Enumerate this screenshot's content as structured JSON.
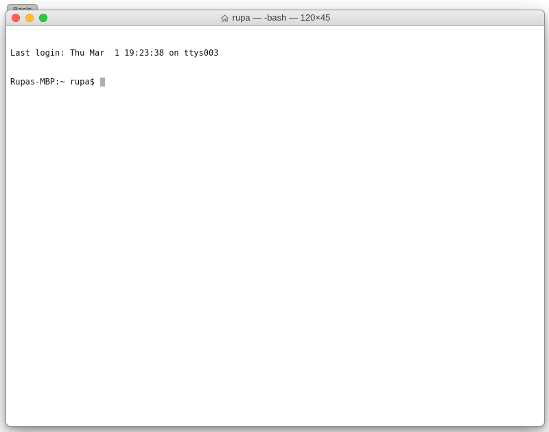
{
  "behind": {
    "tabs": [
      "Basic"
    ]
  },
  "titlebar": {
    "home_icon_name": "home-icon",
    "title": "rupa — -bash — 120×45"
  },
  "terminal": {
    "last_login_line": "Last login: Thu Mar  1 19:23:38 on ttys003",
    "prompt": "Rupas-MBP:~ rupa$ ",
    "command": ""
  }
}
